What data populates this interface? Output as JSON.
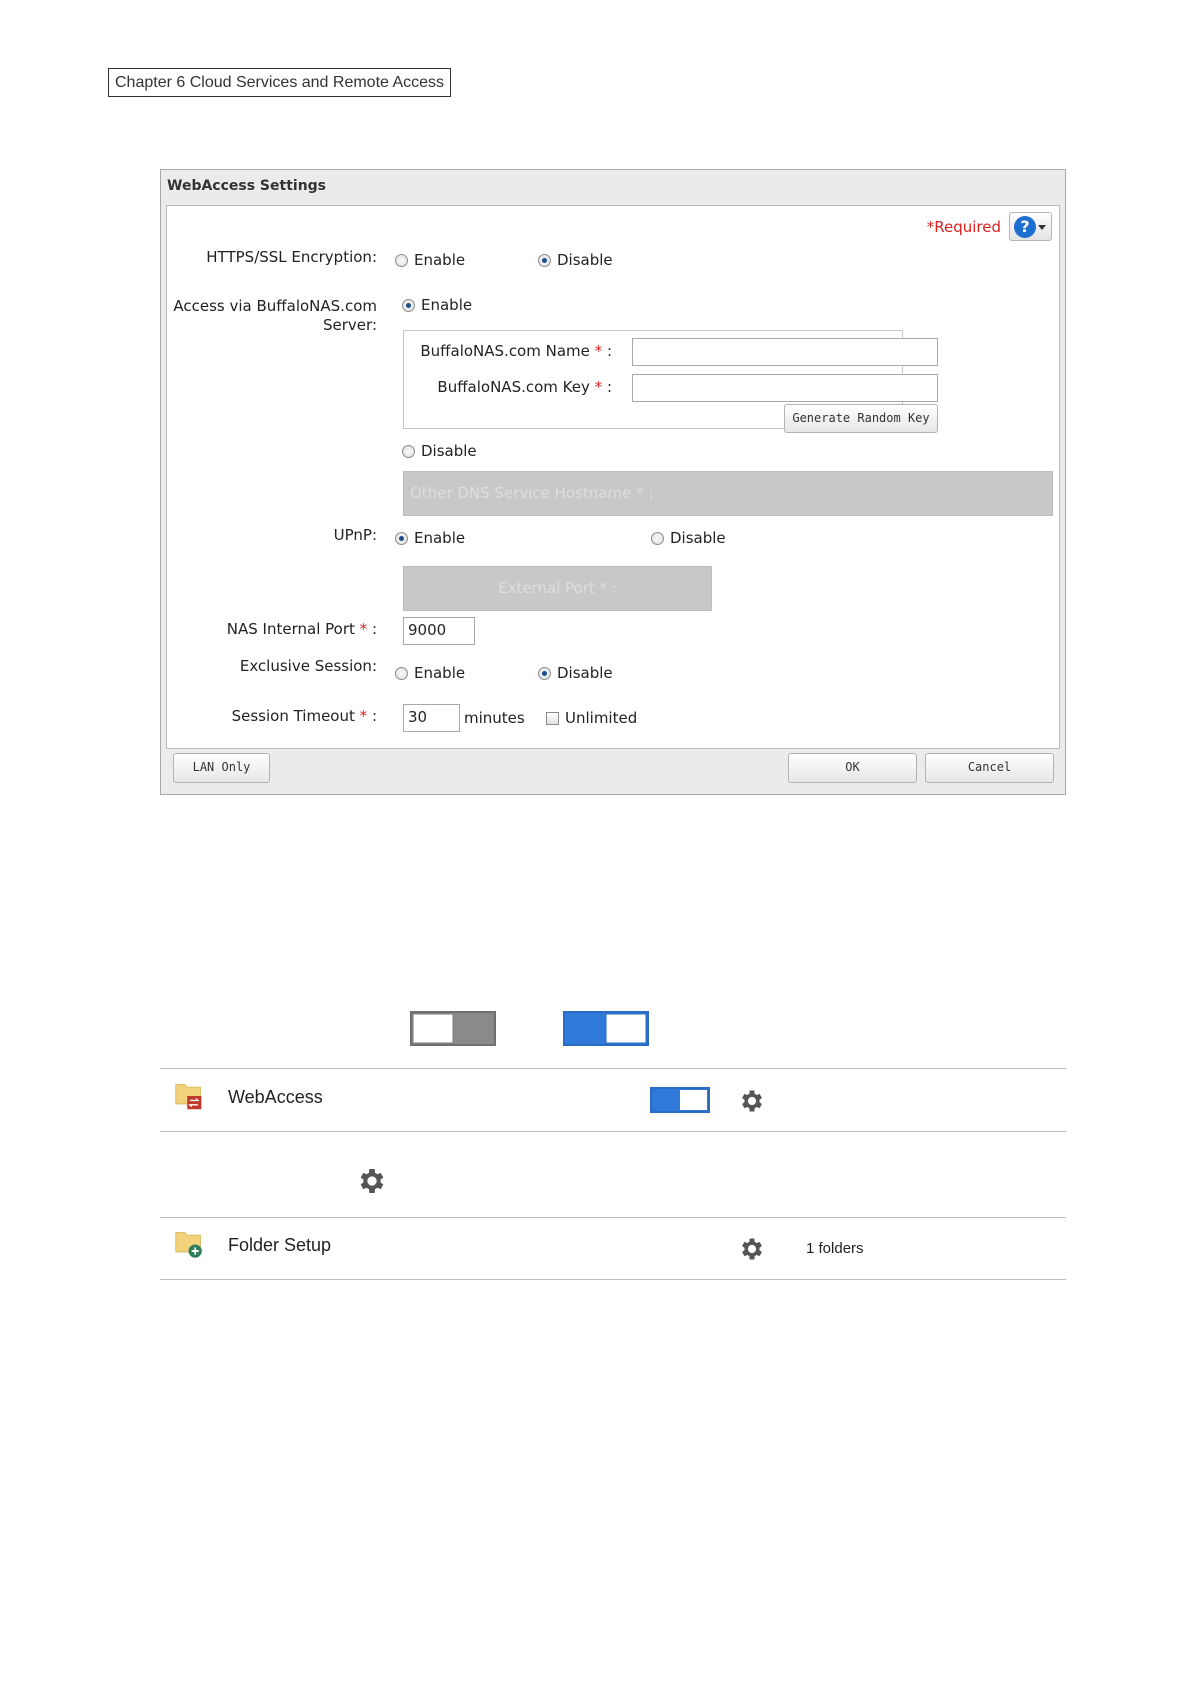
{
  "header": {
    "chapter": "Chapter 6 Cloud Services and Remote Access"
  },
  "dialog": {
    "title": "WebAccess Settings",
    "required_note": "*Required",
    "help_symbol": "?",
    "https": {
      "label": "HTTPS/SSL Encryption:",
      "enable": "Enable",
      "disable": "Disable",
      "selected": "Disable"
    },
    "access": {
      "label_line1": "Access via BuffaloNAS.com",
      "label_line2": "Server:",
      "enable": "Enable",
      "selected": "Enable",
      "name_label": "BuffaloNAS.com Name",
      "name_value": "",
      "key_label": "BuffaloNAS.com Key",
      "key_value": "",
      "asterisk": "*",
      "colon": ":",
      "generate_button": "Generate Random Key",
      "disable": "Disable",
      "other_dns_placeholder": "Other DNS Service Hostname * :"
    },
    "upnp": {
      "label": "UPnP:",
      "enable": "Enable",
      "disable": "Disable",
      "selected": "Enable",
      "external_port": "External Port * :"
    },
    "nas_port": {
      "label": "NAS Internal Port",
      "value": "9000"
    },
    "exclusive": {
      "label": "Exclusive Session:",
      "enable": "Enable",
      "disable": "Disable",
      "selected": "Disable"
    },
    "timeout": {
      "label": "Session Timeout",
      "value": "30",
      "unit": "minutes",
      "unlimited": "Unlimited",
      "unlimited_checked": false
    },
    "footer": {
      "lan_only": "LAN Only",
      "ok": "OK",
      "cancel": "Cancel"
    }
  },
  "toggles_legend": {
    "off_state": "off",
    "on_state": "on"
  },
  "rows": [
    {
      "icon": "folder-webaccess-icon",
      "label": "WebAccess",
      "toggle_on": true
    },
    {
      "icon": "gear-icon"
    },
    {
      "icon": "folder-add-icon",
      "label": "Folder Setup",
      "count": "1 folders"
    }
  ],
  "colors": {
    "accent": "#2f7ad9",
    "required": "#e02020",
    "gear": "#555555",
    "folder": "#f2d27a"
  }
}
